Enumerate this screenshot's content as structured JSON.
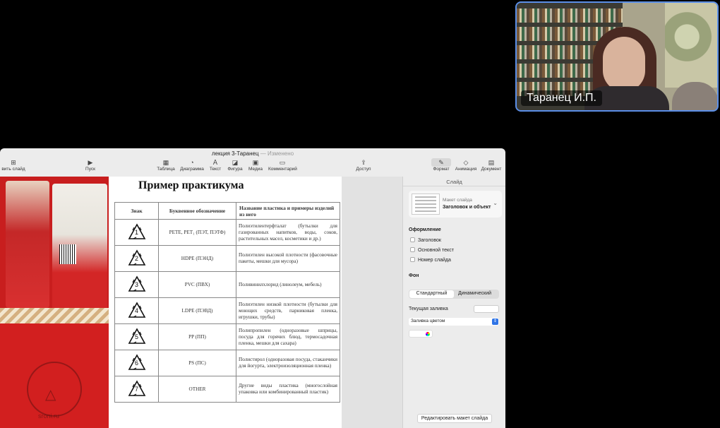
{
  "participant": {
    "name": "Таранец И.П."
  },
  "window": {
    "title": "лекция 3-Таранец",
    "separator": "—",
    "status": "Изменено"
  },
  "toolbar": {
    "add_slide": "вить слайд",
    "play": "Пуск",
    "table": "Таблица",
    "chart": "Диаграмма",
    "text": "Текст",
    "shape": "Фигура",
    "media": "Медиа",
    "comment": "Комментарий",
    "share": "Доступ",
    "format": "Формат",
    "animate": "Анимация",
    "document": "Документ"
  },
  "slide": {
    "title": "Пример практикума",
    "photo_site": "sroni.ru",
    "headers": [
      "Знак",
      "Буквенное обозначение",
      "Название пластика и примеры изделий из него"
    ],
    "rows": [
      {
        "num": "1",
        "code": "PETE, PET₁ (ПЭТ, ПЭТФ)",
        "desc": "Полиэтилентерфталат (бутылки для газированных напитков, воды, соков, растительных масел, косметики и др.)"
      },
      {
        "num": "2",
        "code": "HDPE (ПЭНД)",
        "desc": "Полиэтилен высокой плотности (фасовочные пакеты, мешки для мусора)"
      },
      {
        "num": "3",
        "code": "PVC (ПВХ)",
        "desc": "Поливинилхлорид (линолеум, мебель)"
      },
      {
        "num": "4",
        "code": "LDPE (ПЭВД)",
        "desc": "Полиэтилен низкой плотности (бутылки для моющих средств, парниковая пленка, игрушки, трубы)"
      },
      {
        "num": "5",
        "code": "PP (ПП)",
        "desc": "Полипропилен (одноразовые шприцы, посуда для горячих блюд, термосадочная пленка, мешки для сахара)"
      },
      {
        "num": "6",
        "code": "PS (ПС)",
        "desc": "Полистирол (одноразовая посуда, стаканчики для йогурта, электроизоляционная пленка)"
      },
      {
        "num": "7",
        "code": "OTHER",
        "desc": "Другие виды пластика (многослойная упаковка или комбинированный пластик)"
      }
    ]
  },
  "inspector": {
    "tab": "Слайд",
    "layout_label": "Макет слайда",
    "layout_value": "Заголовок и объект",
    "appearance": "Оформление",
    "chk_title": "Заголовок",
    "chk_body": "Основной текст",
    "chk_number": "Номер слайда",
    "background": "Фон",
    "bg_standard": "Стандартный",
    "bg_dynamic": "Динамический",
    "current_fill": "Текущая заливка",
    "fill_type": "Заливка цветом",
    "edit_layout": "Редактировать макет слайда"
  }
}
